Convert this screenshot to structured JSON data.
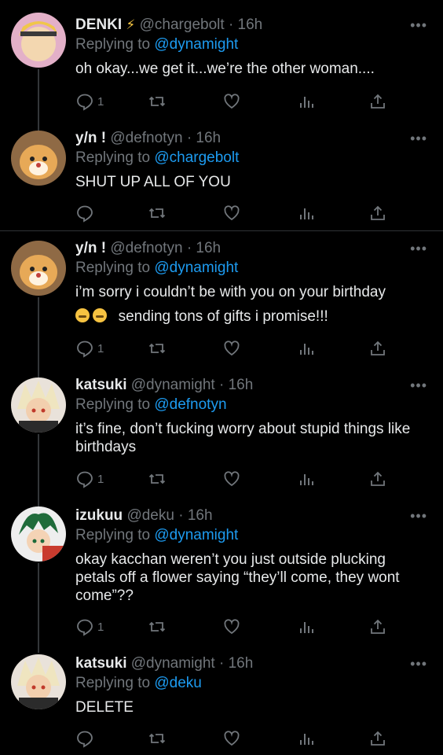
{
  "tweets": [
    {
      "name": "DENKI",
      "badge": "⚡",
      "handle": "@chargebolt",
      "dot": "·",
      "time": "16h",
      "replying_prefix": "Replying to",
      "reply_to": "@dynamight",
      "text": "oh okay...we get it...we’re the other woman....",
      "reply_count": "1",
      "avatar_color": "#d9a441"
    },
    {
      "name": "y/n !",
      "handle": "@defnotyn",
      "dot": "·",
      "time": "16h",
      "replying_prefix": "Replying to",
      "reply_to": "@chargebolt",
      "text": "SHUT UP ALL OF YOU",
      "reply_count": "",
      "avatar_color": "#c98a43"
    },
    {
      "name": "y/n !",
      "handle": "@defnotyn",
      "dot": "·",
      "time": "16h",
      "replying_prefix": "Replying to",
      "reply_to": "@dynamight",
      "text": "i’m sorry i couldn’t be with you on your birthday",
      "text2": "sending tons of gifts i promise!!!",
      "reply_count": "1",
      "avatar_color": "#c98a43"
    },
    {
      "name": "katsuki",
      "handle": "@dynamight",
      "dot": "·",
      "time": "16h",
      "replying_prefix": "Replying to",
      "reply_to": "@defnotyn",
      "text": "it’s fine, don’t fucking worry about stupid things like birthdays",
      "reply_count": "1",
      "avatar_color": "#b33a2a"
    },
    {
      "name": "izukuu",
      "handle": "@deku",
      "dot": "·",
      "time": "16h",
      "replying_prefix": "Replying to",
      "reply_to": "@dynamight",
      "text": "okay kacchan weren’t you just outside plucking petals off a flower saying “they’ll come, they wont come”??",
      "reply_count": "1",
      "avatar_color": "#2e7d4f"
    },
    {
      "name": "katsuki",
      "handle": "@dynamight",
      "dot": "·",
      "time": "16h",
      "replying_prefix": "Replying to",
      "reply_to": "@deku",
      "text": "DELETE",
      "reply_count": "",
      "avatar_color": "#b33a2a"
    }
  ],
  "more_label": "•••",
  "colors": {
    "accent": "#1d9bf0",
    "muted": "#71767b",
    "bg": "#000000"
  }
}
